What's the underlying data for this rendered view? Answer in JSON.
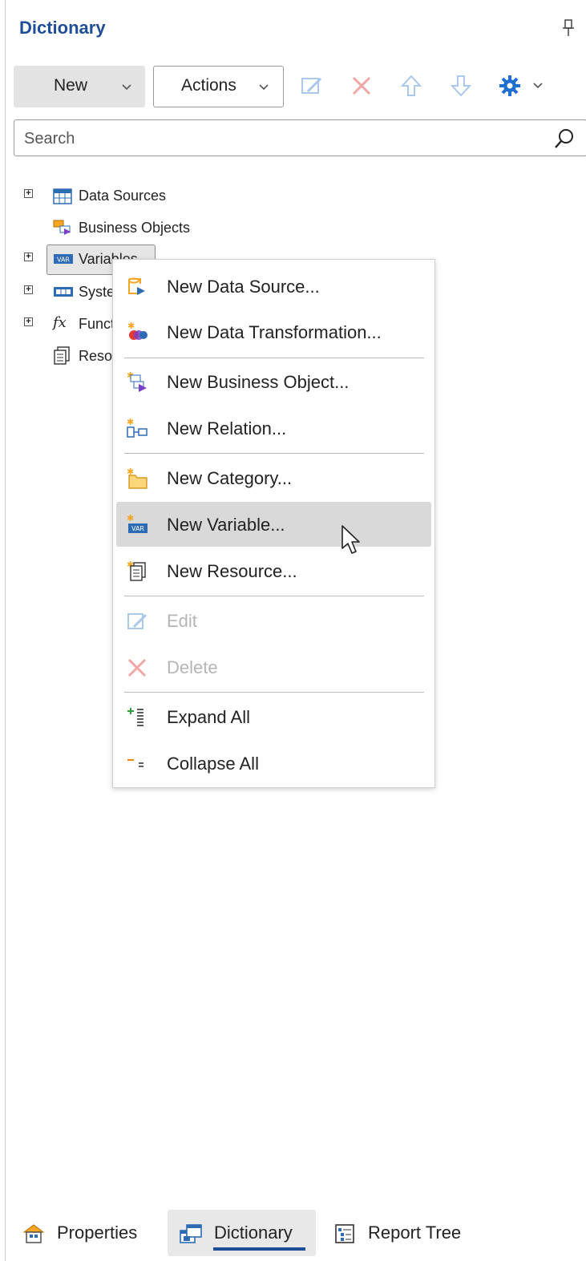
{
  "panel": {
    "title": "Dictionary",
    "pin_icon": "pin-icon"
  },
  "toolbar": {
    "new_label": "New",
    "actions_label": "Actions",
    "icons": [
      "edit-icon",
      "delete-icon",
      "move-up-icon",
      "move-down-icon",
      "settings-icon"
    ]
  },
  "search": {
    "placeholder": "Search",
    "value": ""
  },
  "tree": {
    "items": [
      {
        "label": "Data Sources",
        "icon": "data-sources-icon",
        "expandable": true
      },
      {
        "label": "Business Objects",
        "icon": "business-objects-icon",
        "expandable": false
      },
      {
        "label": "Variables",
        "icon": "variables-icon",
        "expandable": true,
        "selected": true
      },
      {
        "label": "System Variables",
        "icon": "system-variables-icon",
        "expandable": true
      },
      {
        "label": "Functions",
        "icon": "functions-icon",
        "expandable": true
      },
      {
        "label": "Resources",
        "icon": "resources-icon",
        "expandable": false
      }
    ]
  },
  "context_menu": {
    "items": [
      {
        "label": "New Data Source...",
        "icon": "new-data-source-icon",
        "enabled": true
      },
      {
        "label": "New Data Transformation...",
        "icon": "new-data-transformation-icon",
        "enabled": true
      },
      {
        "label": "New Business Object...",
        "icon": "new-business-object-icon",
        "enabled": true
      },
      {
        "label": "New Relation...",
        "icon": "new-relation-icon",
        "enabled": true
      },
      {
        "label": "New Category...",
        "icon": "new-category-icon",
        "enabled": true
      },
      {
        "label": "New Variable...",
        "icon": "new-variable-icon",
        "enabled": true,
        "hovered": true
      },
      {
        "label": "New Resource...",
        "icon": "new-resource-icon",
        "enabled": true
      },
      {
        "label": "Edit",
        "icon": "edit-icon",
        "enabled": false
      },
      {
        "label": "Delete",
        "icon": "delete-icon",
        "enabled": false
      },
      {
        "label": "Expand All",
        "icon": "expand-all-icon",
        "enabled": true
      },
      {
        "label": "Collapse All",
        "icon": "collapse-all-icon",
        "enabled": true
      }
    ]
  },
  "bottom_tabs": [
    {
      "label": "Properties",
      "icon": "properties-icon",
      "active": false
    },
    {
      "label": "Dictionary",
      "icon": "dictionary-icon",
      "active": true
    },
    {
      "label": "Report Tree",
      "icon": "report-tree-icon",
      "active": false
    }
  ],
  "colors": {
    "accent": "#1f4e99",
    "delete": "#e53935",
    "arrow": "#6fa8e6",
    "hover": "#d9d9d9"
  }
}
